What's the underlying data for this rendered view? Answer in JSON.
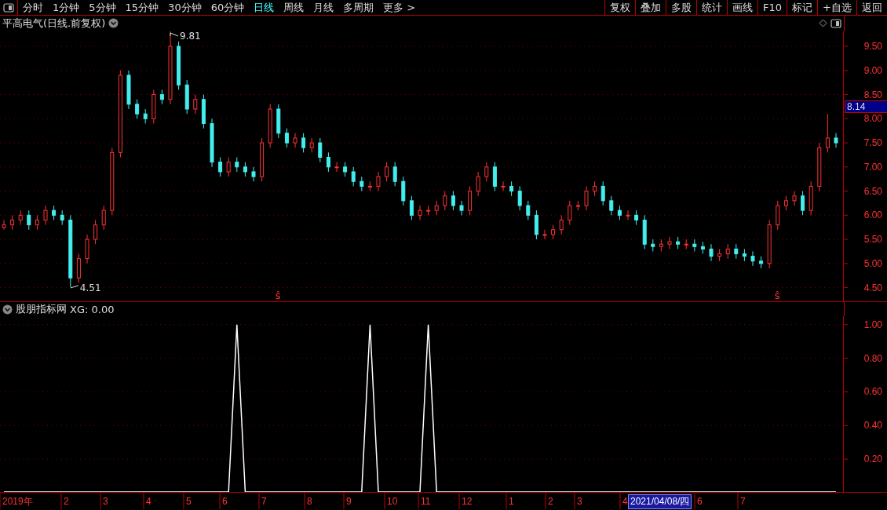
{
  "toolbar": {
    "tabs": [
      {
        "label": "分时",
        "selected": false
      },
      {
        "label": "1分钟",
        "selected": false
      },
      {
        "label": "5分钟",
        "selected": false
      },
      {
        "label": "15分钟",
        "selected": false
      },
      {
        "label": "30分钟",
        "selected": false
      },
      {
        "label": "60分钟",
        "selected": false
      },
      {
        "label": "日线",
        "selected": true
      },
      {
        "label": "周线",
        "selected": false
      },
      {
        "label": "月线",
        "selected": false
      },
      {
        "label": "多周期",
        "selected": false
      },
      {
        "label": "更多 >",
        "selected": false
      }
    ],
    "buttons": [
      "复权",
      "叠加",
      "多股",
      "统计",
      "画线",
      "F10",
      "标记",
      "+自选",
      "返回"
    ]
  },
  "main_chart": {
    "title": "平高电气(日线.前复权)",
    "current_price": "8.14",
    "signal_marks": [
      "ŝ",
      "ŝ"
    ],
    "chart_data": {
      "type": "candlestick",
      "grid": true,
      "ylim": [
        4.2,
        9.81
      ],
      "yticks": [
        {
          "value": 4.5,
          "label": "4.50"
        },
        {
          "value": 5,
          "label": "5.00"
        },
        {
          "value": 5.5,
          "label": "5.50"
        },
        {
          "value": 6,
          "label": "6.00"
        },
        {
          "value": 6.5,
          "label": "6.50"
        },
        {
          "value": 7,
          "label": "7.00"
        },
        {
          "value": 7.5,
          "label": "7.50"
        },
        {
          "value": 8,
          "label": "8.00"
        },
        {
          "value": 8.5,
          "label": "8.50"
        },
        {
          "value": 9,
          "label": "9.00"
        },
        {
          "value": 9.5,
          "label": "9.50"
        }
      ],
      "ohlc": [
        [
          5.75,
          5.9,
          5.7,
          5.8
        ],
        [
          5.8,
          6.0,
          5.7,
          5.9
        ],
        [
          5.9,
          6.1,
          5.8,
          6.0
        ],
        [
          6.0,
          6.1,
          5.7,
          5.8
        ],
        [
          5.8,
          6.0,
          5.7,
          5.9
        ],
        [
          5.9,
          6.2,
          5.8,
          6.1
        ],
        [
          6.1,
          6.2,
          5.9,
          6.0
        ],
        [
          6.0,
          6.1,
          5.8,
          5.9
        ],
        [
          5.9,
          6.0,
          4.51,
          4.7
        ],
        [
          4.7,
          5.2,
          4.6,
          5.1
        ],
        [
          5.1,
          5.6,
          5.0,
          5.5
        ],
        [
          5.5,
          5.9,
          5.4,
          5.8
        ],
        [
          5.8,
          6.2,
          5.7,
          6.1
        ],
        [
          6.1,
          7.4,
          6.0,
          7.3
        ],
        [
          7.3,
          9.0,
          7.2,
          8.9
        ],
        [
          8.9,
          9.0,
          8.2,
          8.3
        ],
        [
          8.3,
          8.4,
          8.0,
          8.1
        ],
        [
          8.1,
          8.2,
          7.9,
          8.0
        ],
        [
          8.0,
          8.6,
          7.9,
          8.5
        ],
        [
          8.5,
          8.6,
          8.3,
          8.4
        ],
        [
          8.4,
          9.81,
          8.3,
          9.5
        ],
        [
          9.5,
          9.6,
          8.6,
          8.7
        ],
        [
          8.7,
          8.8,
          8.1,
          8.2
        ],
        [
          8.2,
          8.5,
          8.1,
          8.4
        ],
        [
          8.4,
          8.5,
          7.8,
          7.9
        ],
        [
          7.9,
          8.0,
          7.0,
          7.1
        ],
        [
          7.1,
          7.2,
          6.8,
          6.9
        ],
        [
          6.9,
          7.2,
          6.8,
          7.1
        ],
        [
          7.1,
          7.2,
          6.9,
          7.0
        ],
        [
          7.0,
          7.1,
          6.8,
          6.9
        ],
        [
          6.9,
          7.0,
          6.7,
          6.8
        ],
        [
          6.8,
          7.6,
          6.7,
          7.5
        ],
        [
          7.5,
          8.3,
          7.4,
          8.2
        ],
        [
          8.2,
          8.3,
          7.6,
          7.7
        ],
        [
          7.7,
          7.8,
          7.4,
          7.5
        ],
        [
          7.5,
          7.7,
          7.4,
          7.6
        ],
        [
          7.6,
          7.7,
          7.3,
          7.4
        ],
        [
          7.4,
          7.6,
          7.3,
          7.5
        ],
        [
          7.5,
          7.6,
          7.1,
          7.2
        ],
        [
          7.2,
          7.3,
          6.9,
          7.0
        ],
        [
          7.0,
          7.1,
          6.9,
          7.0
        ],
        [
          7.0,
          7.1,
          6.8,
          6.9
        ],
        [
          6.9,
          7.0,
          6.6,
          6.7
        ],
        [
          6.7,
          6.8,
          6.5,
          6.6
        ],
        [
          6.6,
          6.7,
          6.5,
          6.6
        ],
        [
          6.6,
          6.9,
          6.5,
          6.8
        ],
        [
          6.8,
          7.1,
          6.7,
          7.0
        ],
        [
          7.0,
          7.1,
          6.6,
          6.7
        ],
        [
          6.7,
          6.8,
          6.2,
          6.3
        ],
        [
          6.3,
          6.4,
          5.9,
          6.0
        ],
        [
          6.0,
          6.2,
          5.9,
          6.1
        ],
        [
          6.1,
          6.2,
          6.0,
          6.1
        ],
        [
          6.1,
          6.3,
          6.0,
          6.2
        ],
        [
          6.2,
          6.5,
          6.1,
          6.4
        ],
        [
          6.4,
          6.5,
          6.1,
          6.2
        ],
        [
          6.2,
          6.3,
          6.0,
          6.1
        ],
        [
          6.1,
          6.6,
          6.0,
          6.5
        ],
        [
          6.5,
          6.9,
          6.4,
          6.8
        ],
        [
          6.8,
          7.1,
          6.7,
          7.0
        ],
        [
          7.0,
          7.1,
          6.5,
          6.6
        ],
        [
          6.6,
          6.7,
          6.5,
          6.6
        ],
        [
          6.6,
          6.7,
          6.4,
          6.5
        ],
        [
          6.5,
          6.6,
          6.1,
          6.2
        ],
        [
          6.2,
          6.3,
          5.9,
          6.0
        ],
        [
          6.0,
          6.1,
          5.5,
          5.6
        ],
        [
          5.6,
          5.7,
          5.5,
          5.6
        ],
        [
          5.6,
          5.8,
          5.5,
          5.7
        ],
        [
          5.7,
          6.0,
          5.6,
          5.9
        ],
        [
          5.9,
          6.3,
          5.8,
          6.2
        ],
        [
          6.2,
          6.3,
          6.1,
          6.2
        ],
        [
          6.2,
          6.6,
          6.1,
          6.5
        ],
        [
          6.5,
          6.7,
          6.4,
          6.6
        ],
        [
          6.6,
          6.7,
          6.2,
          6.3
        ],
        [
          6.3,
          6.4,
          6.0,
          6.1
        ],
        [
          6.1,
          6.2,
          5.9,
          6.0
        ],
        [
          6.0,
          6.1,
          5.9,
          6.0
        ],
        [
          6.0,
          6.1,
          5.8,
          5.9
        ],
        [
          5.9,
          6.0,
          5.3,
          5.4
        ],
        [
          5.4,
          5.5,
          5.25,
          5.35
        ],
        [
          5.35,
          5.5,
          5.25,
          5.4
        ],
        [
          5.4,
          5.55,
          5.3,
          5.45
        ],
        [
          5.45,
          5.55,
          5.3,
          5.4
        ],
        [
          5.4,
          5.5,
          5.3,
          5.4
        ],
        [
          5.4,
          5.5,
          5.25,
          5.35
        ],
        [
          5.35,
          5.45,
          5.2,
          5.3
        ],
        [
          5.3,
          5.4,
          5.05,
          5.15
        ],
        [
          5.15,
          5.3,
          5.05,
          5.2
        ],
        [
          5.2,
          5.4,
          5.1,
          5.3
        ],
        [
          5.3,
          5.4,
          5.1,
          5.2
        ],
        [
          5.2,
          5.3,
          5.05,
          5.15
        ],
        [
          5.15,
          5.25,
          4.95,
          5.05
        ],
        [
          5.05,
          5.15,
          4.9,
          5.0
        ],
        [
          5.0,
          5.9,
          4.9,
          5.8
        ],
        [
          5.8,
          6.3,
          5.7,
          6.2
        ],
        [
          6.2,
          6.4,
          6.1,
          6.3
        ],
        [
          6.3,
          6.5,
          6.2,
          6.4
        ],
        [
          6.4,
          6.5,
          6.0,
          6.1
        ],
        [
          6.1,
          6.7,
          6.0,
          6.6
        ],
        [
          6.6,
          7.5,
          6.5,
          7.4
        ],
        [
          7.4,
          8.1,
          7.3,
          7.6
        ],
        [
          7.6,
          7.7,
          7.4,
          7.5
        ]
      ],
      "annotations": [
        "9.81",
        "4.51"
      ]
    }
  },
  "indicator": {
    "title": "股朋指标网",
    "reading": "XG: 0.00",
    "chart_data": {
      "type": "line",
      "grid": true,
      "ylim": [
        0,
        1.05
      ],
      "yticks": [
        {
          "value": 0.2,
          "label": "0.20"
        },
        {
          "value": 0.4,
          "label": "0.40"
        },
        {
          "value": 0.6,
          "label": "0.60"
        },
        {
          "value": 0.8,
          "label": "0.80"
        },
        {
          "value": 1,
          "label": "1.00"
        }
      ],
      "series": [
        {
          "color": "#ffffff",
          "values": [
            0,
            0,
            0,
            0,
            0,
            0,
            0,
            0,
            0,
            0,
            0,
            0,
            0,
            0,
            0,
            0,
            0,
            0,
            0,
            0,
            0,
            0,
            0,
            0,
            0,
            0,
            0,
            0,
            1,
            0,
            0,
            0,
            0,
            0,
            0,
            0,
            0,
            0,
            0,
            0,
            0,
            0,
            0,
            0,
            1,
            0,
            0,
            0,
            0,
            0,
            0,
            1,
            0,
            0,
            0,
            0,
            0,
            0,
            0,
            0,
            0,
            0,
            0,
            0,
            0,
            0,
            0,
            0,
            0,
            0,
            0,
            0,
            0,
            0,
            0,
            0,
            0,
            0,
            0,
            0,
            0,
            0,
            0,
            0,
            0,
            0,
            0,
            0,
            0,
            0,
            0,
            0,
            0,
            0,
            0,
            0,
            0,
            0,
            0,
            0,
            0
          ]
        }
      ]
    }
  },
  "date_axis": {
    "labels": [
      "2019年",
      "2",
      "3",
      "4",
      "5",
      "6",
      "7",
      "8",
      "9",
      "10",
      "11",
      "12",
      "1",
      "2",
      "3",
      "4",
      "6",
      "7"
    ],
    "cursor_date": "2021/04/08/四"
  }
}
